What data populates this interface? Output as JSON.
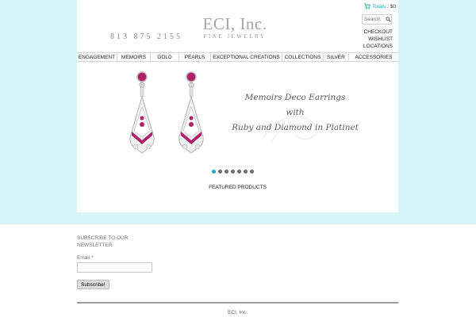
{
  "header": {
    "phone": "813 875 2155",
    "logo_title": "ECI, Inc.",
    "logo_subtitle": "FINE JEWELRY",
    "cart_label": "Totals",
    "cart_total": ": $0",
    "search_placeholder": "Search",
    "links": [
      "CHECKOUT",
      "WISHLIST",
      "LOCATIONS"
    ]
  },
  "nav": {
    "items": [
      "ENGAGEMENT",
      "MEMOIRS",
      "GOLD",
      "PEARLS",
      "EXCEPTIONAL CREATIONS",
      "COLLECTIONS",
      "SILVER",
      "ACCESSORIES"
    ]
  },
  "slider": {
    "line1": "Memoirs Deco Earrings",
    "line2": "with",
    "line3": "Ruby and Diamond in Platinet",
    "slide_count": 7,
    "active_slide": 1
  },
  "featured_title": "FEATURED PRODUCTS",
  "newsletter": {
    "title": "SUBSCRIBE TO OUR NEWSLETTER",
    "email_label": "Email",
    "required_mark": "*",
    "button_label": "Subscribe!"
  },
  "footer": {
    "text": "ECI, Inc."
  },
  "colors": {
    "page_bg": "#d6f5f7",
    "accent": "#24a6b3",
    "ruby": "#b0216a"
  }
}
